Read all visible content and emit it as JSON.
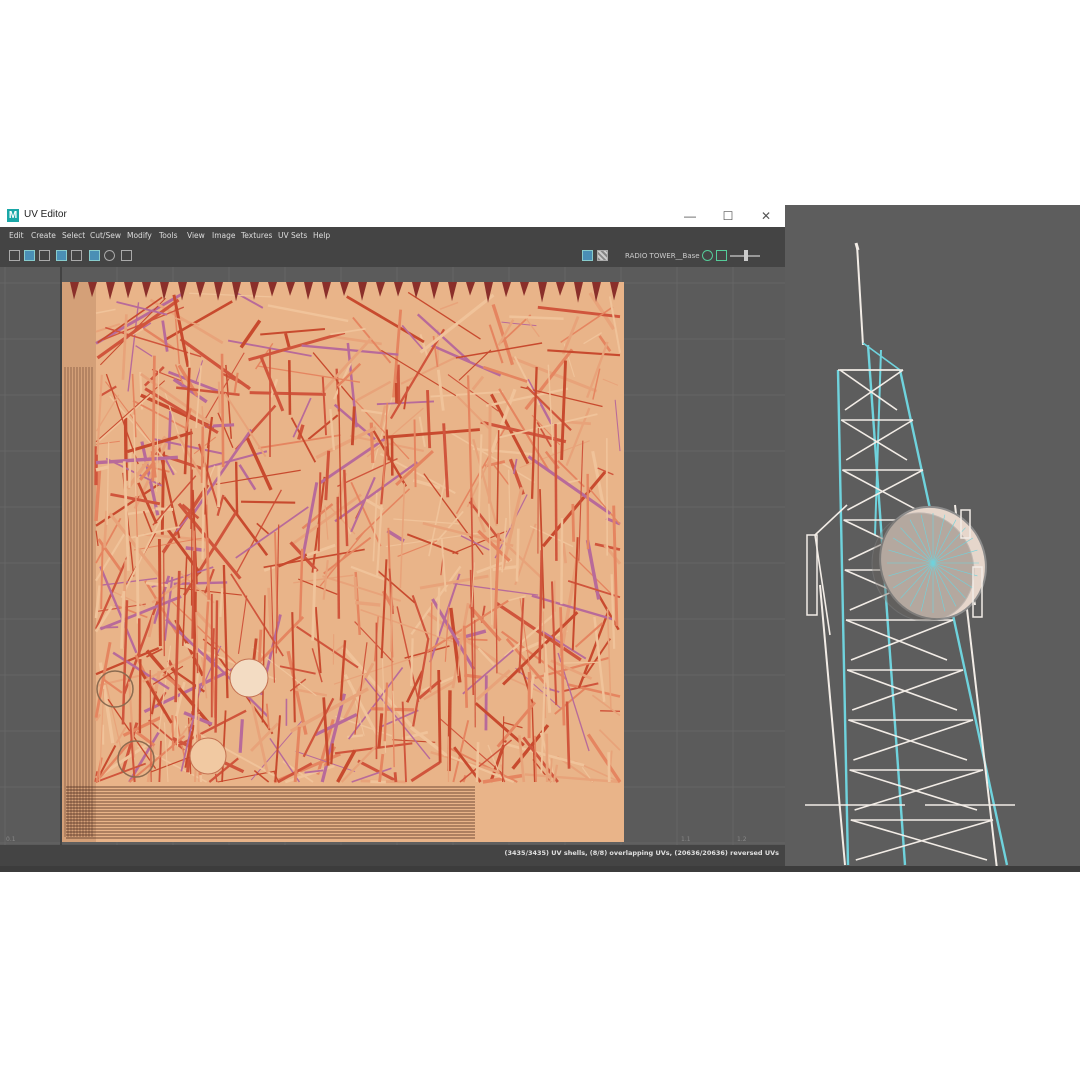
{
  "window": {
    "title": "UV Editor",
    "app_icon": "M"
  },
  "menu": [
    "Edit",
    "Create",
    "Select",
    "Cut/Sew",
    "Modify",
    "Tools",
    "View",
    "Image",
    "Textures",
    "UV Sets",
    "Help"
  ],
  "toolbar": {
    "uv_set_label": "RADIO TOWER__Base"
  },
  "axis_labels": {
    "left": "0.1",
    "right1": "1.1",
    "right2": "1.2"
  },
  "status": {
    "text": "(3435/3435) UV shells, (8/8) overlapping UVs, (20636/20636) reversed UVs"
  },
  "colors": {
    "wire_select": "#6fd3dd",
    "wire_default": "#f2ece6",
    "uv_fill": "#e9b489",
    "uv_edge": "#c84a2e"
  },
  "icons": [
    "maya-icon",
    "minimize-icon",
    "maximize-icon",
    "close-icon"
  ]
}
